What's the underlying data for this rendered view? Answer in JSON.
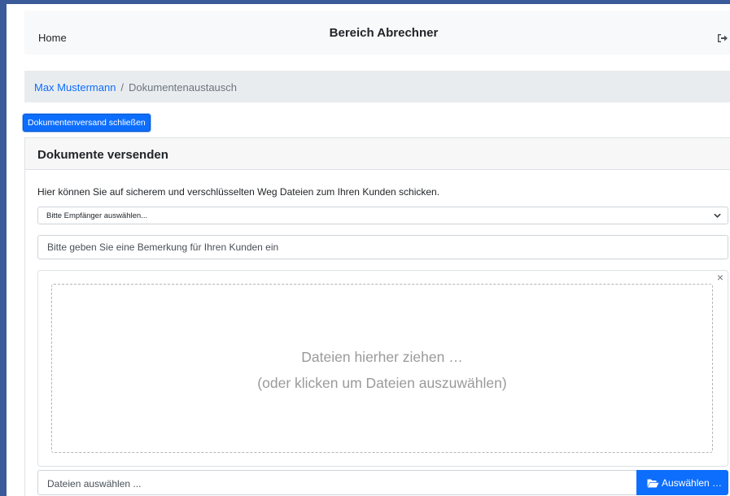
{
  "navbar": {
    "home_label": "Home",
    "title": "Bereich Abrechner",
    "logout_icon": "logout-icon"
  },
  "breadcrumb": {
    "user": "Max Mustermann",
    "separator": "/",
    "current": "Dokumentenaustausch"
  },
  "actions": {
    "close_sending_label": "Dokumentenversand schließen"
  },
  "card": {
    "title": "Dokumente versenden",
    "intro": "Hier können Sie auf sicherem und verschlüsselten Weg Dateien zum Ihren Kunden schicken.",
    "recipient_select": "Bitte Empfänger auswählen...",
    "remark_placeholder": "Bitte geben Sie eine Bemerkung für Ihren Kunden ein",
    "dropzone": {
      "close_symbol": "×",
      "line1": "Dateien hierher ziehen …",
      "line2": "(oder klicken um Dateien auszuwählen)"
    },
    "file_caption": "Dateien auswählen ...",
    "browse_label": "Auswählen …"
  },
  "colors": {
    "primary": "#0d6efd",
    "frame": "#3a5a9a"
  }
}
